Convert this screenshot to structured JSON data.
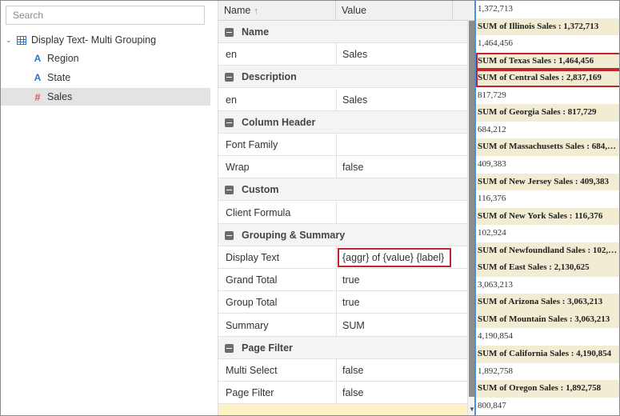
{
  "tree": {
    "search_placeholder": "Search",
    "root_label": "Display Text- Multi Grouping",
    "items": [
      {
        "label": "Region",
        "icon": "text-attribute-icon"
      },
      {
        "label": "State",
        "icon": "text-attribute-icon"
      },
      {
        "label": "Sales",
        "icon": "numeric-measure-icon"
      }
    ]
  },
  "grid": {
    "col_name": "Name",
    "col_value": "Value",
    "sort_arrow": "↑",
    "rows": [
      {
        "type": "section",
        "label": "Name"
      },
      {
        "type": "prop",
        "name": "en",
        "value": "Sales"
      },
      {
        "type": "section",
        "label": "Description"
      },
      {
        "type": "prop",
        "name": "en",
        "value": "Sales"
      },
      {
        "type": "section",
        "label": "Column Header"
      },
      {
        "type": "prop",
        "name": "Font Family",
        "value": ""
      },
      {
        "type": "prop",
        "name": "Wrap",
        "value": "false"
      },
      {
        "type": "section",
        "label": "Custom"
      },
      {
        "type": "prop",
        "name": "Client Formula",
        "value": ""
      },
      {
        "type": "section",
        "label": "Grouping & Summary"
      },
      {
        "type": "prop",
        "name": "Display Text",
        "value": "{aggr} of {value} {label}",
        "highlight": true
      },
      {
        "type": "prop",
        "name": "Grand Total",
        "value": "true"
      },
      {
        "type": "prop",
        "name": "Group Total",
        "value": "true"
      },
      {
        "type": "prop",
        "name": "Summary",
        "value": "SUM"
      },
      {
        "type": "section",
        "label": "Page Filter"
      },
      {
        "type": "prop",
        "name": "Multi Select",
        "value": "false"
      },
      {
        "type": "prop",
        "name": "Page Filter",
        "value": "false"
      }
    ]
  },
  "preview": {
    "rows": [
      {
        "text": "1,372,713",
        "summary": false
      },
      {
        "text": "SUM of Illinois Sales : 1,372,713",
        "summary": true
      },
      {
        "text": "1,464,456",
        "summary": false
      },
      {
        "text": "SUM of Texas Sales : 1,464,456",
        "summary": true,
        "boxed": true
      },
      {
        "text": "SUM of Central Sales : 2,837,169",
        "summary": true,
        "boxed": true
      },
      {
        "text": "817,729",
        "summary": false
      },
      {
        "text": "SUM of Georgia Sales : 817,729",
        "summary": true
      },
      {
        "text": "684,212",
        "summary": false
      },
      {
        "text": "SUM of Massachusetts Sales : 684,…",
        "summary": true
      },
      {
        "text": "409,383",
        "summary": false
      },
      {
        "text": "SUM of New Jersey Sales : 409,383",
        "summary": true
      },
      {
        "text": "116,376",
        "summary": false
      },
      {
        "text": "SUM of New York Sales : 116,376",
        "summary": true
      },
      {
        "text": "102,924",
        "summary": false
      },
      {
        "text": "SUM of Newfoundland Sales : 102,…",
        "summary": true
      },
      {
        "text": "SUM of East Sales : 2,130,625",
        "summary": true
      },
      {
        "text": "3,063,213",
        "summary": false
      },
      {
        "text": "SUM of Arizona Sales : 3,063,213",
        "summary": true
      },
      {
        "text": "SUM of Mountain Sales : 3,063,213",
        "summary": true
      },
      {
        "text": "4,190,854",
        "summary": false
      },
      {
        "text": "SUM of California Sales : 4,190,854",
        "summary": true
      },
      {
        "text": "1,892,758",
        "summary": false
      },
      {
        "text": "SUM of Oregon Sales : 1,892,758",
        "summary": true
      },
      {
        "text": "800,847",
        "summary": false
      }
    ]
  },
  "colors": {
    "highlight_border": "#c0262c",
    "summary_row_bg": "#f2ecd3",
    "selected_tree_bg": "#e3e3e3",
    "attribute_icon": "#2a73d4",
    "measure_icon": "#e05a5a",
    "preview_divider": "#4a90e2"
  }
}
